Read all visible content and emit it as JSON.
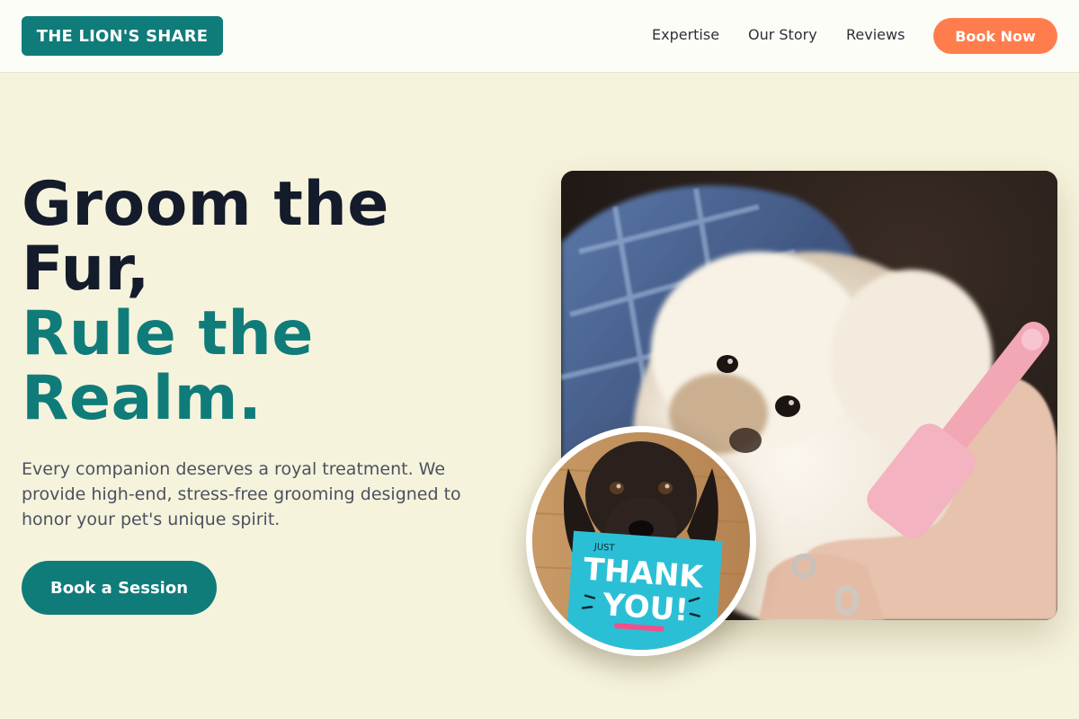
{
  "header": {
    "logo": "THE LION'S SHARE",
    "nav": [
      {
        "label": "Expertise"
      },
      {
        "label": "Our Story"
      },
      {
        "label": "Reviews"
      }
    ],
    "book_now": "Book Now"
  },
  "hero": {
    "title_line1": "Groom the",
    "title_line2": "Fur,",
    "title_line3": "Rule the",
    "title_line4": "Realm.",
    "description": "Every companion deserves a royal treatment. We provide high-end, stress-free grooming designed to honor your pet's unique spirit.",
    "cta": "Book a Session"
  },
  "images": {
    "main_alt": "white fluffy dog being brushed",
    "round_alt": "black spaniel holding thank you card",
    "card_small": "JUST",
    "card_line1": "THANK",
    "card_line2": "YOU!"
  },
  "colors": {
    "brand": "#0f7c7a",
    "accent": "#ff7d4d",
    "background": "#f6f3dc"
  }
}
